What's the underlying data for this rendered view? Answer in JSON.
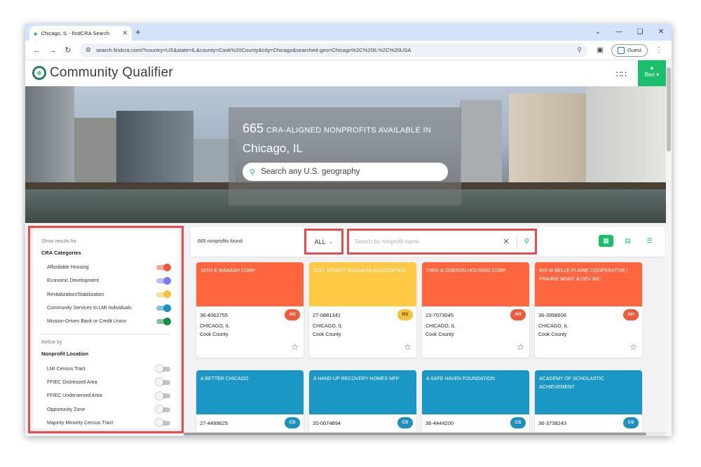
{
  "browser": {
    "tab_title": "Chicago, IL - findCRA Search",
    "url": "search.findcra.com/?country=US&state=IL&county=Cook%20County&city=Chicago&searched-geo=Chicago%2C%20IL%2C%20USA",
    "profile_label": "Guest"
  },
  "app": {
    "name": "Community Qualifier",
    "user_label": "Ben"
  },
  "hero": {
    "count": "665",
    "count_label": "CRA-ALIGNED NONPROFITS AVAILABLE IN",
    "city": "Chicago, IL",
    "search_placeholder": "Search any U.S. geography"
  },
  "sidebar": {
    "show_hint": "Show results for",
    "categories_title": "CRA Categories",
    "categories": [
      {
        "label": "Affordable Housing",
        "color": "#f05a3a",
        "on": true
      },
      {
        "label": "Economic Development",
        "color": "#7c7cf0",
        "on": true
      },
      {
        "label": "Revitalization/Stabilization",
        "color": "#f5c23e",
        "on": true
      },
      {
        "label": "Community Services to LMI Individuals",
        "color": "#1e8fc2",
        "on": true
      },
      {
        "label": "Mission-Driven Bank or Credit Union",
        "color": "#1a8a47",
        "on": true
      }
    ],
    "refine_hint": "Refine by",
    "location_title": "Nonprofit Location",
    "locations": [
      {
        "label": "LMI Census Tract",
        "on": false
      },
      {
        "label": "FFIEC Distressed Area",
        "on": false
      },
      {
        "label": "FFIEC Underserved Area",
        "on": false
      },
      {
        "label": "Opportunity Zone",
        "on": false
      },
      {
        "label": "Majority Minority Census Tract",
        "on": false
      }
    ]
  },
  "results": {
    "found_label": "665 nonprofits found",
    "filter_value": "ALL",
    "search_placeholder": "Search by nonprofit name",
    "cards": [
      {
        "name": "18TH & WABASH CORP",
        "ein": "36-4062755",
        "badge": "AH",
        "city": "CHICAGO, IL",
        "county": "Cook County",
        "band_color": "#ff6640",
        "badge_color": "#f05a3a"
      },
      {
        "name": "51ST STREET BUSINESS ASSOCIATION",
        "ein": "27-0881341",
        "badge": "RS",
        "city": "CHICAGO, IL",
        "county": "Cook County",
        "band_color": "#ffc845",
        "badge_color": "#f5c23e"
      },
      {
        "name": "73RD & DOBSON HOUSING CORP",
        "ein": "23-7073045",
        "badge": "AH",
        "city": "CHICAGO, IL",
        "county": "Cook County",
        "band_color": "#ff6640",
        "badge_color": "#f05a3a"
      },
      {
        "name": "820 W BELLE PLAINE COOPERATIVE | PRAIRIE MGMT & DEV INC",
        "ein": "36-3998606",
        "badge": "AH",
        "city": "CHICAGO, IL",
        "county": "Cook County",
        "band_color": "#ff6640",
        "badge_color": "#f05a3a"
      },
      {
        "name": "A BETTER CHICAGO",
        "ein": "27-4499625",
        "badge": "CS",
        "city": "",
        "county": "",
        "band_color": "#1a97c4",
        "badge_color": "#1e8fc2"
      },
      {
        "name": "A HAND UP RECOVERY HOMES NFP",
        "ein": "20-0074894",
        "badge": "CS",
        "city": "",
        "county": "",
        "band_color": "#1a97c4",
        "badge_color": "#1e8fc2"
      },
      {
        "name": "A SAFE HAVEN FOUNDATION",
        "ein": "36-4444200",
        "badge": "CS",
        "city": "",
        "county": "",
        "band_color": "#1a97c4",
        "badge_color": "#1e8fc2"
      },
      {
        "name": "ACADEMY OF SCHOLASTIC ACHIEVEMENT",
        "ein": "36-3738243",
        "badge": "CS",
        "city": "",
        "county": "",
        "band_color": "#1a97c4",
        "badge_color": "#1e8fc2"
      }
    ]
  }
}
